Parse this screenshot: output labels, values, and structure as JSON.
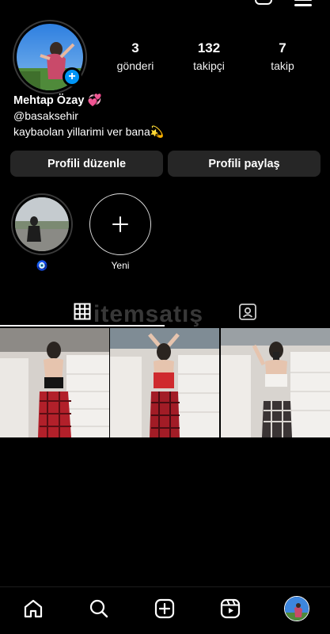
{
  "profile": {
    "display_name": "Mehtap Özay 💞",
    "username": "@basaksehir",
    "bio": "kaybaolan yillarimi ver bana💫"
  },
  "stats": [
    {
      "value": "3",
      "label": "gönderi"
    },
    {
      "value": "132",
      "label": "takipçi"
    },
    {
      "value": "7",
      "label": "takip"
    }
  ],
  "buttons": {
    "edit_profile": "Profili düzenle",
    "share_profile": "Profili paylaş"
  },
  "highlights": [
    {
      "label": "🧿"
    },
    {
      "label": "Yeni"
    }
  ],
  "watermark": "itemsatış",
  "icons": {
    "grid": "grid-icon",
    "tagged": "tagged-icon",
    "home": "home-icon",
    "search": "search-icon",
    "create": "create-icon",
    "reels": "reels-icon"
  },
  "colors": {
    "background": "#000000",
    "button": "#262626",
    "accent": "#0095f6"
  }
}
